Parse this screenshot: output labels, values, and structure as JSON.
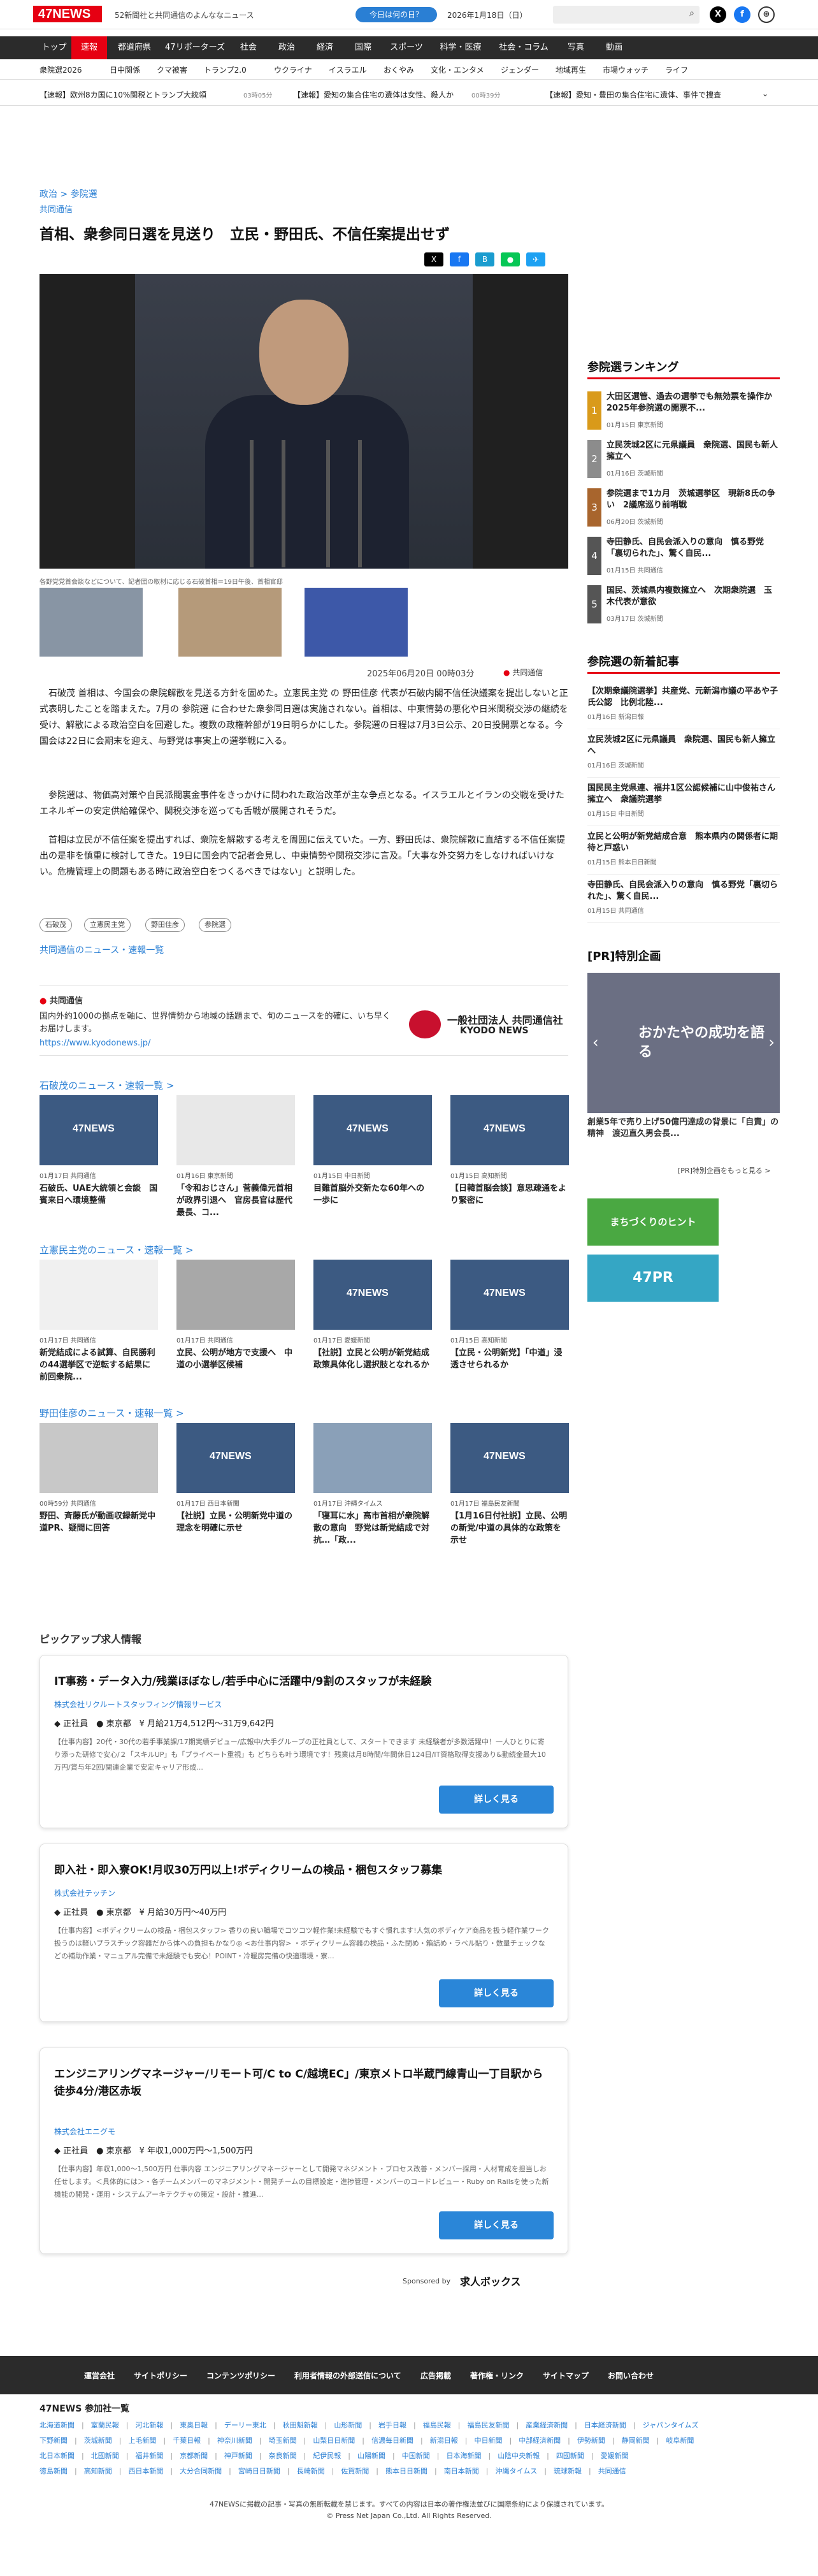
{
  "header": {
    "logo": "47NEWS",
    "tagline": "52新聞社と共同通信のよんななニュース",
    "fortune_button": "今日は何の日？",
    "date": "2026年1月18日（日）",
    "search_icon": "search-icon"
  },
  "nav_main": [
    "トップ",
    "速報",
    "都道府県",
    "47リポーターズ",
    "社会",
    "政治",
    "経済",
    "国際",
    "スポーツ",
    "科学・医療",
    "社会・コラム",
    "写真",
    "動画"
  ],
  "nav_sub": [
    "衆院選2026",
    "日中関係",
    "クマ被害",
    "トランプ2.0",
    "ウクライナ",
    "イスラエル",
    "おくやみ",
    "文化・エンタメ",
    "ジェンダー",
    "地域再生",
    "市場ウォッチ",
    "ライフ"
  ],
  "ticker": [
    "【速報】欧州8カ国に10%関税とトランプ大統領",
    "03時05分",
    "【速報】愛知の集合住宅の遺体は女性、殺人か",
    "00時39分",
    "【速報】愛知・豊田の集合住宅に遺体、事件で捜査"
  ],
  "article": {
    "breadcrumb": "政治 > 参院選",
    "source": "共同通信",
    "title": "首相、衆参同日選を見送り　立民・野田氏、不信任案提出せず",
    "caption": "各野党党首会談などについて、記者団の取材に応じる石破首相＝19日午後、首相官邸",
    "pubdate": "2025年06月20日 00時03分",
    "publisher": "共同通信",
    "paragraphs": [
      "石破茂 首相は、今国会の衆院解散を見送る方針を固めた。立憲民主党 の 野田佳彦 代表が石破内閣不信任決議案を提出しないと正式表明したことを踏まえた。7月の 参院選 に合わせた衆参同日選は実施されない。首相は、中東情勢の悪化や日米関税交渉の継続を受け、解散による政治空白を回避した。複数の政権幹部が19日明らかにした。参院選の日程は7月3日公示、20日投開票となる。今国会は22日に会期末を迎え、与野党は事実上の選挙戦に入る。",
      "参院選は、物価高対策や自民派閥裏金事件をきっかけに問われた政治改革が主な争点となる。イスラエルとイランの交戦を受けたエネルギーの安定供給確保や、関税交渉を巡っても舌戦が展開されそうだ。",
      "首相は立民が不信任案を提出すれば、衆院を解散する考えを周囲に伝えていた。一方、野田氏は、衆院解散に直結する不信任案提出の是非を慎重に検討してきた。19日に国会内で記者会見し、中東情勢や関税交渉に言及。「大事な外交努力をしなければいけない。危機管理上の問題もある時に政治空白をつくるべきではない」と説明した。"
    ],
    "tags": [
      "石破茂",
      "立憲民主党",
      "野田佳彦",
      "参院選"
    ],
    "more_link": "共同通信のニュース・速報一覧"
  },
  "kyodo": {
    "label": "共同通信",
    "desc": "国内外約1000の拠点を軸に、世界情勢から地域の話題まで、旬のニュースを的確に、いち早くお届けします。",
    "url": "https://www.kyodonews.jp/",
    "logo_text": "一般社団法人 共同通信社",
    "logo_sub": "KYODO NEWS"
  },
  "related": [
    {
      "heading": "石破茂のニュース・速報一覧 >",
      "items": [
        {
          "meta": "01月17日 共同通信",
          "title": "石破氏、UAE大統領と会談　国賓来日へ環境整備"
        },
        {
          "meta": "01月16日 東京新聞",
          "title": "「令和おじさん」菅義偉元首相が政界引退へ　官房長官は歴代最長、コ..."
        },
        {
          "meta": "01月15日 中日新聞",
          "title": "目難首脳外交新たな60年への一歩に"
        },
        {
          "meta": "01月15日 高知新聞",
          "title": "【日韓首脳会談】意思疎通をより緊密に"
        }
      ]
    },
    {
      "heading": "立憲民主党のニュース・速報一覧 >",
      "items": [
        {
          "meta": "01月17日 共同通信",
          "title": "新党結成による試算、自民勝利の44選挙区で逆転する結果に　前回衆院..."
        },
        {
          "meta": "01月17日 共同通信",
          "title": "立民、公明が地方で支援へ　中道の小選挙区候補"
        },
        {
          "meta": "01月17日 愛媛新聞",
          "title": "【社説】立民と公明が新党結成政策具体化し選択肢となれるか"
        },
        {
          "meta": "01月15日 高知新聞",
          "title": "【立民・公明新党】「中道」浸透させられるか"
        }
      ]
    },
    {
      "heading": "野田佳彦のニュース・速報一覧 >",
      "items": [
        {
          "meta": "00時59分 共同通信",
          "title": "野田、斉藤氏が動画収録新党中道PR、疑問に回答"
        },
        {
          "meta": "01月17日 西日本新聞",
          "title": "【社説】立民・公明新党中道の理念を明確に示せ"
        },
        {
          "meta": "01月17日 沖縄タイムス",
          "title": "「寝耳に水」高市首相が衆院解散の意向　野党は新党結成で対抗…「政..."
        },
        {
          "meta": "01月17日 福島民友新聞",
          "title": "【1月16日付社説】立民、公明の新党/中道の具体的な政策を示せ"
        }
      ]
    }
  ],
  "sidebar": {
    "ranking_title": "参院選ランキング",
    "ranking": [
      {
        "n": "1",
        "title": "大田区選管、過去の選挙でも無効票を操作か　2025年参院選の開票不...",
        "meta": "01月15日 東京新聞"
      },
      {
        "n": "2",
        "title": "立民茨城2区に元県議員　衆院選、国民も新人擁立へ",
        "meta": "01月16日 茨城新聞"
      },
      {
        "n": "3",
        "title": "参院選まで1カ月　茨城選挙区　現新8氏の争い　2議席巡り前哨戦",
        "meta": "06月20日 茨城新聞"
      },
      {
        "n": "4",
        "title": "寺田静氏、自民会派入りの意向　慎る野党「裏切られた」、驚く自民...",
        "meta": "01月15日 共同通信"
      },
      {
        "n": "5",
        "title": "国民、茨城県内複数擁立へ　次期衆院選　玉木代表が意欲",
        "meta": "03月17日 茨城新聞"
      }
    ],
    "newest_title": "参院選の新着記事",
    "newest": [
      {
        "title": "【次期衆議院選挙】共産党、元新潟市議の平あや子氏公認　比例北陸...",
        "meta": "01月16日 新潟日報"
      },
      {
        "title": "立民茨城2区に元県議員　衆院選、国民も新人擁立へ",
        "meta": "01月16日 茨城新聞"
      },
      {
        "title": "国民民主党県連、福井1区公認候補に山中俊祐さん擁立へ　衆議院選挙",
        "meta": "01月15日 中日新聞"
      },
      {
        "title": "立民と公明が新党結成合意　熊本県内の関係者に期待と戸惑い",
        "meta": "01月15日 熊本日日新聞"
      },
      {
        "title": "寺田静氏、自民会派入りの意向　慎る野党「裏切られた」、驚く自民...",
        "meta": "01月15日 共同通信"
      }
    ],
    "pr_title": "[PR]特別企画",
    "pr_banner_title": "おかたやの成功を語る",
    "pr_caption": "創業5年で売り上げ50億円達成の背景に「自責」の精神　渡辺直久男会長...",
    "pr_more": "[PR]特別企画をもっと見る >",
    "ad1": "まちづくりのヒント",
    "ad2": "47PR"
  },
  "jobs": {
    "heading": "ピックアップ求人情報",
    "items": [
      {
        "title": "IT事務・データ入力/残業ほぼなし/若手中心に活躍中/9割のスタッフが未経験",
        "company": "株式会社リクルートスタッフィング情報サービス",
        "type": "正社員",
        "place": "東京都",
        "salary": "月給21万4,512円〜31万9,642円",
        "desc": "【仕事内容】20代・30代の若手事業課/17期実績デビュー/広報中/大手グループの正社員として、スタートできます 未経験者が多数活躍中！一人ひとりに寄り添った研修で安心/２「スキルUP」も「プライベート重視」も どちらも叶う環境です！残業は月8時間/年間休日124日/IT資格取得支援あり&勤続金最大10万円/賞与年2回/関連企業で安定キャリア形成...",
        "btn": "詳しく見る"
      },
      {
        "title": "即入社・即入寮OK!月収30万円以上!ボディクリームの検品・梱包スタッフ募集",
        "company": "株式会社テッチン",
        "type": "正社員",
        "place": "東京都",
        "salary": "月給30万円〜40万円",
        "desc": "【仕事内容】<ボディクリームの検品・梱包スタッフ> 香りの良い職場でコツコツ軽作業!未経験でもすぐ慣れます!人気のボディケア商品を扱う軽作業ワーク 扱うのは軽いプラスチック容器だから体への負担もかなり◎ <お仕事内容> ・ボディクリーム容器の検品・ふた閉め・箱詰め・ラベル貼り・数量チェックなどの補助作業・マニュアル完備で未経験でも安心！POINT・冷暖房完備の快適環境・寮...",
        "btn": "詳しく見る"
      },
      {
        "title": "エンジニアリングマネージャー/リモート可/C to C/越境EC」/東京メトロ半蔵門線青山一丁目駅から徒歩4分/港区赤坂",
        "company": "株式会社エニグモ",
        "type": "正社員",
        "place": "東京都",
        "salary": "年収1,000万円〜1,500万円",
        "desc": "【仕事内容】年収1,000〜1,500万円 仕事内容 エンジニアリングマネージャーとして開発マネジメント・プロセス改善・メンバー採用・人材育成を担当しお任せします。＜具体的には＞・各チームメンバーのマネジメント・開発チームの目標設定・進捗管理・メンバーのコードレビュー・Ruby on Railsを使った新機能の開発・運用・システムアーキテクチャの策定・設計・推進...",
        "btn": "詳しく見る"
      }
    ],
    "sponsored": "Sponsored by",
    "sponsor": "求人ボックス"
  },
  "footer": {
    "links": [
      "運営会社",
      "サイトポリシー",
      "コンテンツポリシー",
      "利用者情報の外部送信について",
      "広告掲載",
      "著作権・リンク",
      "サイトマップ",
      "お問い合わせ"
    ],
    "partner_title": "47NEWS 参加社一覧",
    "partners": [
      [
        "北海道新聞",
        "室蘭民報",
        "河北新報",
        "東奥日報",
        "デーリー東北",
        "秋田魁新報",
        "山形新聞",
        "岩手日報",
        "福島民報",
        "福島民友新聞",
        "産業経済新聞",
        "日本経済新聞",
        "ジャパンタイムズ"
      ],
      [
        "下野新聞",
        "茨城新聞",
        "上毛新聞",
        "千葉日報",
        "神奈川新聞",
        "埼玉新聞",
        "山梨日日新聞",
        "信濃毎日新聞",
        "新潟日報",
        "中日新聞",
        "中部経済新聞",
        "伊勢新聞",
        "静岡新聞",
        "岐阜新聞"
      ],
      [
        "北日本新聞",
        "北國新聞",
        "福井新聞",
        "京都新聞",
        "神戸新聞",
        "奈良新聞",
        "紀伊民報",
        "山陽新聞",
        "中国新聞",
        "日本海新聞",
        "山陰中央新報",
        "四國新聞",
        "愛媛新聞"
      ],
      [
        "徳島新聞",
        "高知新聞",
        "西日本新聞",
        "大分合同新聞",
        "宮崎日日新聞",
        "長崎新聞",
        "佐賀新聞",
        "熊本日日新聞",
        "南日本新聞",
        "沖縄タイムス",
        "琉球新報",
        "共同通信"
      ]
    ],
    "note": "47NEWSに掲載の記事・写真の無断転載を禁じます。すべての内容は日本の著作権法並びに国際条約により保護されています。",
    "copyright": "© Press Net Japan Co.,Ltd. All Rights Reserved."
  },
  "colors": {
    "accent": "#e60012",
    "link": "#2a7fd4",
    "navbar": "#2b2b2b"
  }
}
